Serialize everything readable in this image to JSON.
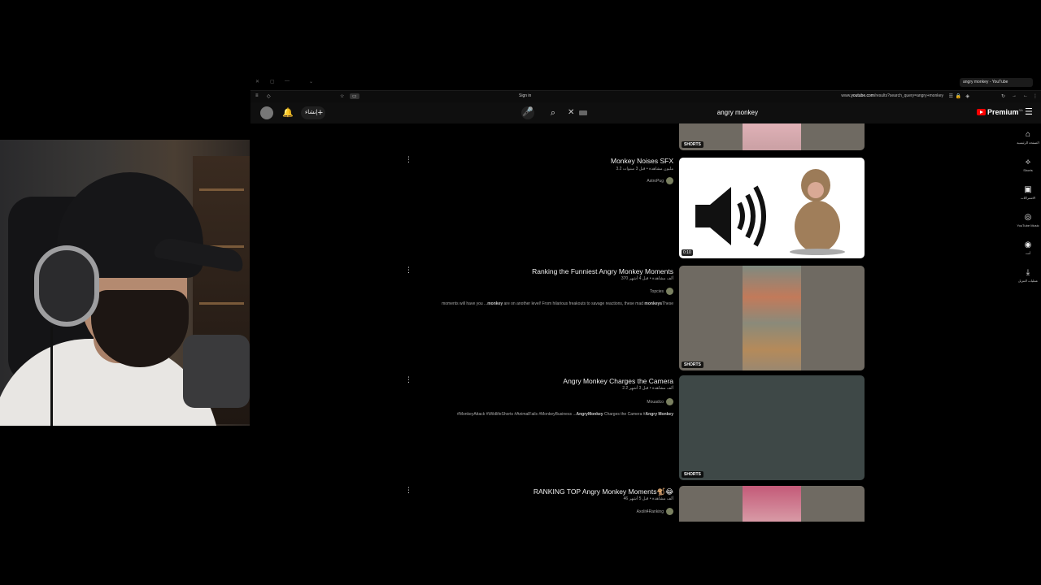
{
  "browser": {
    "tab_title": "angry monkey - YouTube",
    "sign_in": "Sign in",
    "url_prefix": "www.",
    "url_host": "youtube.com",
    "url_path": "/results?search_query=angry+monkey"
  },
  "header": {
    "create_label": "إنشاء",
    "search_query": "angry monkey",
    "logo_text": "Premium",
    "region": "SA"
  },
  "guide": [
    {
      "label": "الصفحة الرئيسية",
      "icon": "home-icon"
    },
    {
      "label": "Shorts",
      "icon": "shorts-icon"
    },
    {
      "label": "الاشتراكات",
      "icon": "subscriptions-icon"
    },
    {
      "label": "YouTube Music",
      "icon": "music-icon"
    },
    {
      "label": "أنت",
      "icon": "you-icon"
    },
    {
      "label": "عمليات التنزيل",
      "icon": "download-icon"
    }
  ],
  "results": [
    {
      "title": "",
      "badge": "SHORTS"
    },
    {
      "title": "Monkey Noises SFX",
      "meta": "3.2 مليون مشاهدة • قبل 3 سنوات",
      "channel": "AstroPug",
      "duration": "0:10"
    },
    {
      "title": "Ranking the Funniest Angry Monkey Moments",
      "meta": "370 ألف مشاهدة • قبل 4 أشهر",
      "channel": "Topcies",
      "desc_pre": "moments will have you ...",
      "desc_bold1": "monkey",
      "desc_mid": " are on another level! From hilarious freakouts to savage reactions, these mad ",
      "desc_bold2": "monkeys",
      "desc_post": "These",
      "badge": "SHORTS"
    },
    {
      "title": "Angry Monkey Charges the Camera",
      "meta": "2.2 ألف مشاهدة • قبل 3 أشهر",
      "channel": "Mouadco",
      "desc_pre": "#MonkeyAttack #WildlifeShorts #AnimalFails #MonkeyBusiness ...",
      "desc_bold1": "AngryMonkey",
      "desc_mid": " Charges the Camera #",
      "desc_bold2": "Angry Monkey",
      "desc_post": "",
      "badge": "SHORTS"
    },
    {
      "title": "RANKING TOP Angry Monkey Moments🐒😂",
      "meta": "46 ألف مشاهدة • قبل 5 أشهر",
      "channel": "Axolit4Ranking"
    }
  ]
}
